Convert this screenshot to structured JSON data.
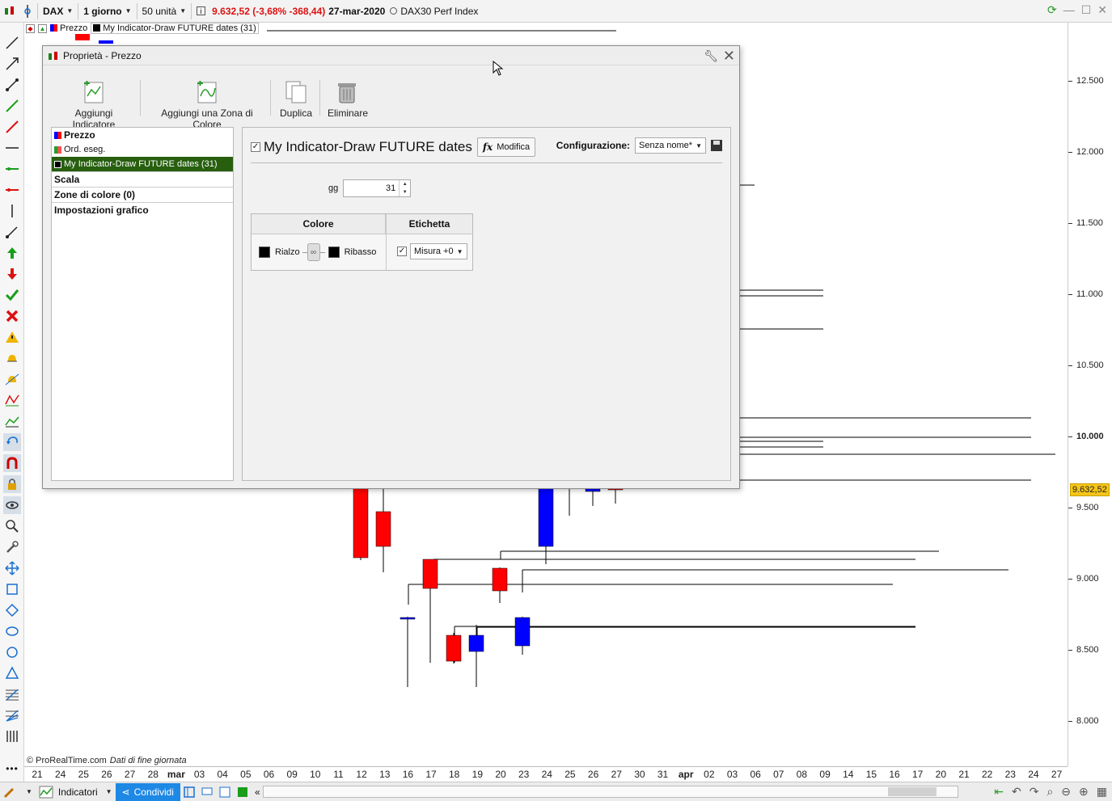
{
  "topbar": {
    "instrument": "DAX",
    "timeframe": "1 giorno",
    "units": "50 unità",
    "quote": "9.632,52 (-3,68% -368,44)",
    "date": "27-mar-2020",
    "instrument_name": "DAX30 Perf Index"
  },
  "legend": {
    "price_label": "Prezzo",
    "indicator_label": "My Indicator-Draw FUTURE dates (31)"
  },
  "dialog": {
    "title": "Proprietà - Prezzo",
    "toolbar": {
      "add_indicator": "Aggiungi Indicatore",
      "add_color_zone": "Aggiungi una Zona di Colore",
      "duplicate": "Duplica",
      "delete": "Eliminare"
    },
    "left_items": {
      "price": "Prezzo",
      "orders": "Ord. eseg.",
      "indicator": "My Indicator-Draw FUTURE dates (31)",
      "scale": "Scala",
      "color_zones": "Zone di colore (0)",
      "chart_settings": "Impostazioni grafico"
    },
    "indicator_title": "My Indicator-Draw FUTURE dates",
    "edit_button": "Modifica",
    "configuration_label": "Configurazione:",
    "configuration_value": "Senza nome*",
    "gg_label": "gg",
    "gg_value": "31",
    "table": {
      "col_color": "Colore",
      "col_label": "Etichetta",
      "up_label": "Rialzo",
      "down_label": "Ribasso",
      "label_select": "Misura +0"
    }
  },
  "yaxis": {
    "ticks": [
      "12.500",
      "12.000",
      "11.500",
      "11.000",
      "10.500",
      "10.000",
      "9.500",
      "9.000",
      "8.500",
      "8.000"
    ],
    "last_price": "9.632,52"
  },
  "xaxis": {
    "labels": [
      "21",
      "24",
      "25",
      "26",
      "27",
      "28",
      "mar",
      "03",
      "04",
      "05",
      "06",
      "09",
      "10",
      "11",
      "12",
      "13",
      "16",
      "17",
      "18",
      "19",
      "20",
      "23",
      "24",
      "25",
      "26",
      "27",
      "30",
      "31",
      "apr",
      "02",
      "03",
      "06",
      "07",
      "08",
      "09",
      "14",
      "15",
      "16",
      "17",
      "20",
      "21",
      "22",
      "23",
      "24",
      "27"
    ]
  },
  "footer": {
    "copyright": "© ProRealTime.com",
    "data_note": "Dati di fine giornata",
    "indicators_button": "Indicatori",
    "share_button": "Condividi"
  },
  "colors": {
    "up": "#0000ff",
    "down": "#ff0000",
    "selected_item": "#275f0f",
    "last_price_bg": "#f5c518"
  }
}
